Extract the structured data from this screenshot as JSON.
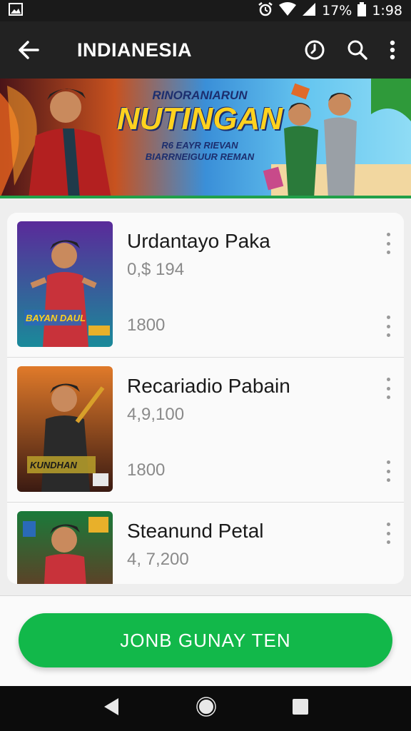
{
  "status": {
    "battery": "17%",
    "time": "1:98"
  },
  "appbar": {
    "title": "INDIANESIA"
  },
  "banner": {
    "kicker": "RINORANIARUN",
    "title": "NUTINGAN",
    "subtitle_1": "R6 EAYR RIEVAN",
    "subtitle_2": "BIARRNEIGUUR REMAN"
  },
  "items": [
    {
      "title": "Urdantayo Paka",
      "subtitle": "0,$ 194",
      "count": "1800",
      "badge": "BAYAN DAUL"
    },
    {
      "title": "Recariadio Pabain",
      "subtitle": "4,9,100",
      "count": "1800",
      "badge": "KUNDHAN"
    },
    {
      "title": "Steanund Petal",
      "subtitle": "4, 7,200",
      "count": "",
      "badge": ""
    }
  ],
  "cta": {
    "label": "JONB GUNAY TEN"
  },
  "colors": {
    "accent_green": "#12b84a",
    "appbar": "#222222",
    "status_bar": "#1a1a1a"
  }
}
